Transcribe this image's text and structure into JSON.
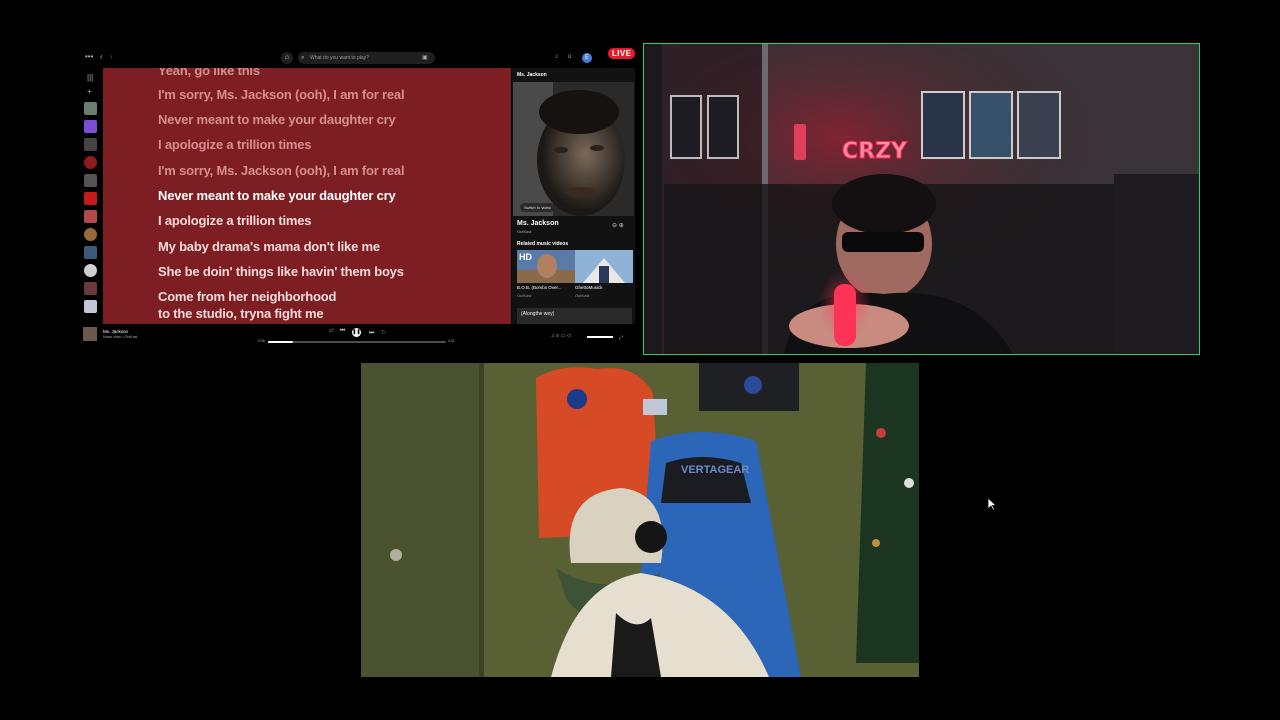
{
  "spotify": {
    "search_placeholder": "What do you want to play?",
    "live_badge": "LIVE",
    "avatar_letter": "E",
    "lyrics": [
      {
        "text": "Yeah, go like this",
        "state": "past"
      },
      {
        "text": "I'm sorry, Ms. Jackson (ooh), I am for real",
        "state": "past"
      },
      {
        "text": "Never meant to make your daughter cry",
        "state": "past"
      },
      {
        "text": "I apologize a trillion times",
        "state": "past"
      },
      {
        "text": "I'm sorry, Ms. Jackson (ooh), I am for real",
        "state": "past"
      },
      {
        "text": "Never meant to make your daughter cry",
        "state": "active"
      },
      {
        "text": "I apologize a trillion times",
        "state": "future"
      },
      {
        "text": "My baby drama's mama don't like me",
        "state": "future"
      },
      {
        "text": "She be doin' things like havin' them boys",
        "state": "future"
      },
      {
        "text": "Come from her neighborhood",
        "state": "future"
      },
      {
        "text": "to the studio, tryna fight me",
        "state": "future"
      }
    ],
    "now_playing": {
      "header": "Ms. Jackson",
      "switch_label": "Switch to video",
      "song": "Ms. Jackson",
      "artist": "OutKast",
      "related_heading": "Related music videos",
      "related": [
        {
          "title": "B.O.B. (Bombs Over...",
          "sub": "OutKast"
        },
        {
          "title": "GhettoMusick",
          "sub": "OutKast"
        }
      ],
      "more_label": "(Alongthe wey)"
    },
    "player": {
      "song": "Ms. Jackson",
      "sub": "Music video • OutKast",
      "time_elapsed": "0:36",
      "time_total": "4:31",
      "progress": 0.14
    }
  },
  "colors": {
    "lyrics_bg": "#7d1e22",
    "cam_border": "#2ecc71",
    "live": "#e21d2b"
  },
  "cam1": {
    "neon_sign": "CRZY"
  },
  "cam2": {
    "chair_brand": "VERTAGEAR"
  }
}
